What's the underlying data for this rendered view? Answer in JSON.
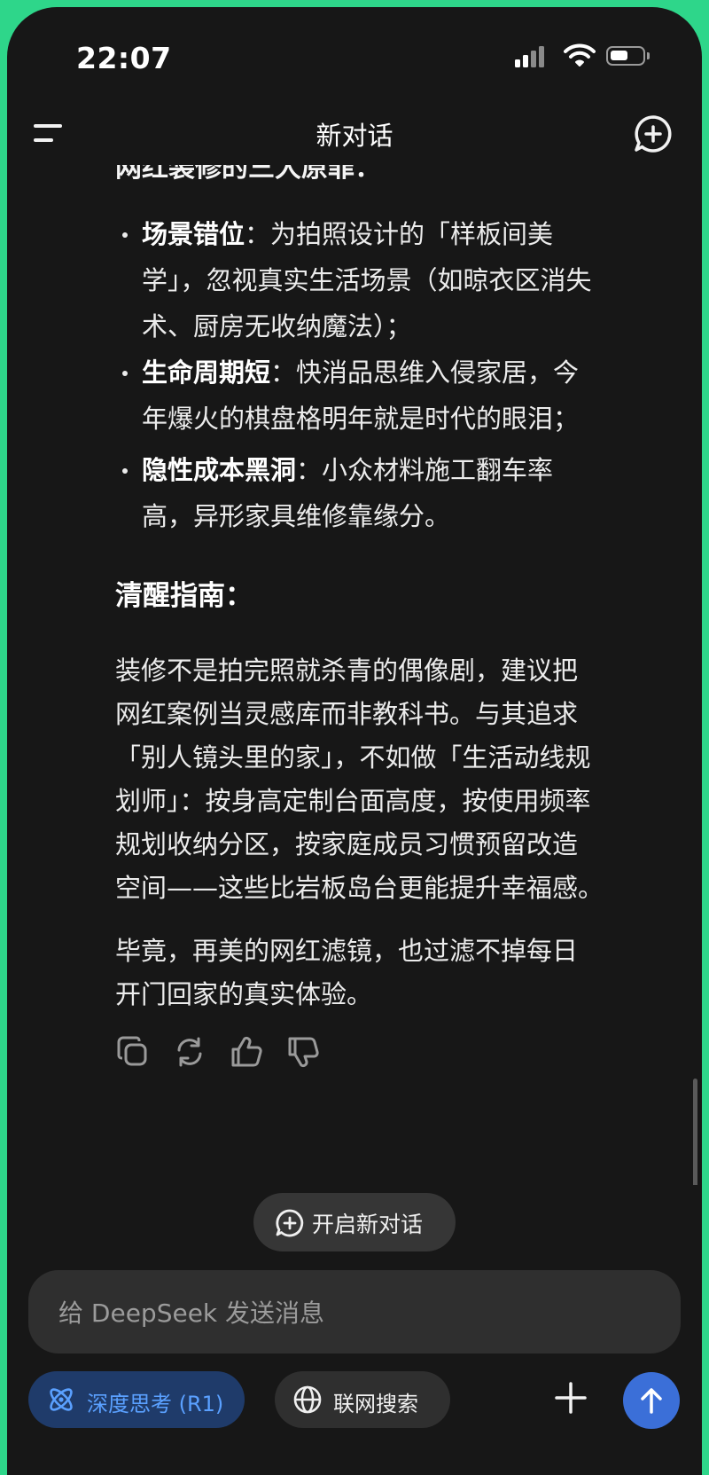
{
  "status_bar": {
    "time": "22:07"
  },
  "header": {
    "title": "新对话"
  },
  "content": {
    "cut_off_heading": "网红装修的三大原罪：",
    "bullets": [
      {
        "term": "场景错位",
        "lines": [
          "：为拍照设计的「样板间美",
          "学」，忽视真实生活场景（如晾衣区消失",
          "术、厨房无收纳魔法）；"
        ]
      },
      {
        "term": "生命周期短",
        "lines": [
          "：快消品思维入侵家居，今",
          "年爆火的棋盘格明年就是时代的眼泪；"
        ]
      },
      {
        "term": "隐性成本黑洞",
        "lines": [
          "：小众材料施工翻车率",
          "高，异形家具维修靠缘分。"
        ]
      }
    ],
    "guide_heading": "清醒指南：",
    "paragraph1_lines": [
      "装修不是拍完照就杀青的偶像剧，建议把",
      "网红案例当灵感库而非教科书。与其追求",
      "「别人镜头里的家」，不如做「生活动线规",
      "划师」：按身高定制台面高度，按使用频率",
      "规划收纳分区，按家庭成员习惯预留改造",
      "空间——这些比岩板岛台更能提升幸福感。"
    ],
    "paragraph2_lines": [
      "毕竟，再美的网红滤镜，也过滤不掉每日",
      "开门回家的真实体验。"
    ]
  },
  "actions": {
    "icons": [
      "copy-icon",
      "regenerate-icon",
      "thumbs-up-icon",
      "thumbs-down-icon"
    ]
  },
  "new_chat_pill": {
    "label": "开启新对话"
  },
  "composer": {
    "placeholder": "给 DeepSeek 发送消息",
    "value": "",
    "deep_think_label": "深度思考 (R1)",
    "web_search_label": "联网搜索",
    "deep_think_active": true
  },
  "colors": {
    "background": "#171717",
    "accent": "#3b6fd8",
    "deep_think_bg": "#1f3b6a",
    "deep_think_text": "#5aa0ff",
    "frame_border": "#2ed68a"
  }
}
